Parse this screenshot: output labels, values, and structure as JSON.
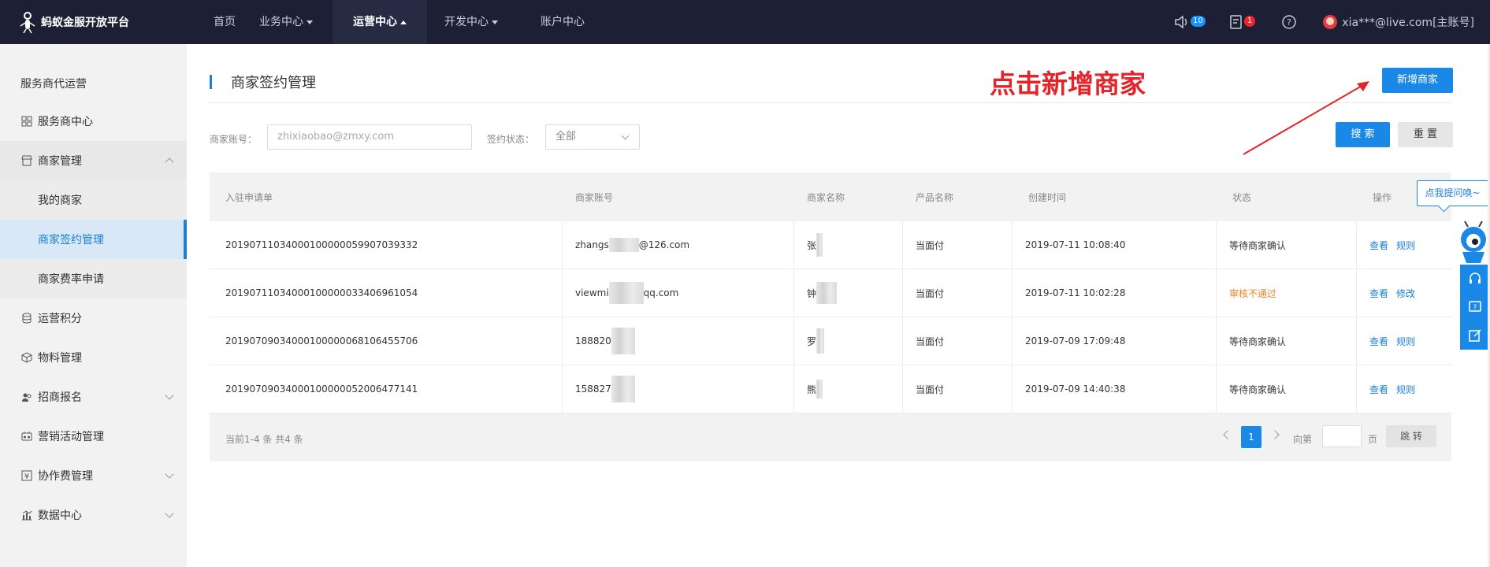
{
  "topbar": {
    "brand": "蚂蚁金服开放平台",
    "nav": [
      {
        "label": "首页",
        "has_caret": false,
        "active": false
      },
      {
        "label": "业务中心",
        "has_caret": true,
        "active": false
      },
      {
        "label": "运营中心",
        "has_caret": true,
        "active": true
      },
      {
        "label": "开发中心",
        "has_caret": true,
        "active": false
      },
      {
        "label": "账户中心",
        "has_caret": false,
        "active": false
      }
    ],
    "notice_count": "10",
    "todo_count": "1",
    "account": "xia***@live.com[主账号]",
    "icons": [
      "speaker-icon",
      "task-icon",
      "help-icon"
    ]
  },
  "sidebar": {
    "title": "服务商代运营",
    "items": [
      {
        "label": "服务商中心",
        "icon": "grid-icon"
      },
      {
        "label": "商家管理",
        "icon": "store-icon",
        "expanded": true
      },
      {
        "label": "我的商家",
        "sub": true
      },
      {
        "label": "商家签约管理",
        "sub": true,
        "selected": true
      },
      {
        "label": "商家费率申请",
        "sub": true
      },
      {
        "label": "运营积分",
        "icon": "database-icon"
      },
      {
        "label": "物料管理",
        "icon": "box-icon"
      },
      {
        "label": "招商报名",
        "icon": "user-group-icon",
        "collapsible": true
      },
      {
        "label": "营销活动管理",
        "icon": "activity-icon"
      },
      {
        "label": "协作费管理",
        "icon": "yuan-icon",
        "collapsible": true
      },
      {
        "label": "数据中心",
        "icon": "chart-icon",
        "collapsible": true
      }
    ]
  },
  "main": {
    "page_title": "商家签约管理",
    "annotation": "点击新增商家",
    "add_button": "新增商家",
    "search_button": "搜 索",
    "reset_button": "重 置",
    "filters": {
      "account_label": "商家账号：",
      "account_placeholder": "zhixiaobao@zmxy.com",
      "status_label": "签约状态：",
      "status_value": "全部"
    },
    "table": {
      "columns": [
        "入驻申请单",
        "商家账号",
        "商家名称",
        "产品名称",
        "创建时间",
        "状态",
        "操作"
      ],
      "rows": [
        {
          "id": "2019071103400010000005990703933​2",
          "account_a": "zhangs",
          "account_b": "@126.com",
          "name": "张",
          "product": "当面付",
          "created": "2019-07-11 10:08:40",
          "status": "等待商家确认",
          "status_warn": false,
          "actions": [
            "查看",
            "规则"
          ]
        },
        {
          "id": "2019071103400010000003340696105​4",
          "account_a": "viewmi",
          "account_b": "qq.com",
          "name": "钟",
          "product": "当面付",
          "created": "2019-07-11 10:02:28",
          "status": "审核不通过",
          "status_warn": true,
          "actions": [
            "查看",
            "修改"
          ]
        },
        {
          "id": "2019070903400010000006810645570​6",
          "account_a": "188820",
          "account_b": "",
          "name": "罗",
          "product": "当面付",
          "created": "2019-07-09 17:09:48",
          "status": "等待商家确认",
          "status_warn": false,
          "actions": [
            "查看",
            "规则"
          ]
        },
        {
          "id": "2019070903400010000005200647714​1",
          "account_a": "158827",
          "account_b": "",
          "name": "熊",
          "product": "当面付",
          "created": "2019-07-09 14:40:38",
          "status": "等待商家确认",
          "status_warn": false,
          "actions": [
            "查看",
            "规则"
          ]
        }
      ]
    },
    "footer": {
      "summary": "当前1-4 条 共4 条",
      "current_page": "1",
      "goto_label": "向第",
      "page_unit": "页",
      "jump_button": "跳 转"
    }
  },
  "floating": {
    "help_bubble": "点我提问唤~",
    "tools": [
      "headset-icon",
      "question-icon",
      "edit-icon"
    ]
  },
  "colors": {
    "topbar": "#1d2035",
    "accent": "#1a88e6",
    "annotation": "#e3242b",
    "warn": "#f0812e"
  }
}
